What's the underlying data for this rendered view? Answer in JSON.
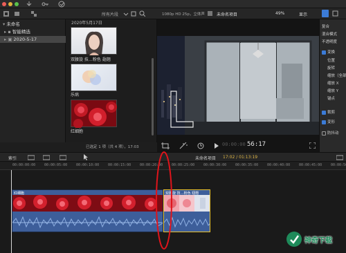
{
  "toolbar": {
    "browser_filter": "所有片段",
    "viewer_format": "1080p HD 25p，立体声",
    "project_name": "未命名项目",
    "zoom": "49%",
    "display_menu": "显示"
  },
  "library": {
    "items": [
      {
        "label": "未命名"
      },
      {
        "label": "智能精选"
      },
      {
        "label": "2020-5-17"
      }
    ]
  },
  "browser": {
    "date_header": "2020年5月17日",
    "clips": [
      {
        "label": "双腰旋 技…粉色 翅翘"
      },
      {
        "label": "乐病"
      },
      {
        "label": "红细胞"
      }
    ],
    "status": "已选定 1 项（共 4 项），17:03"
  },
  "viewer": {
    "timecode": "56:17"
  },
  "inspector": {
    "rows": [
      {
        "label": "复合",
        "check": false
      },
      {
        "label": "混合模式",
        "check": false
      },
      {
        "label": "不透明度",
        "check": false
      },
      {
        "label": "变换",
        "check": true
      },
      {
        "label": "位置",
        "check": false
      },
      {
        "label": "旋转",
        "check": false
      },
      {
        "label": "缩放（全部）",
        "check": false
      },
      {
        "label": "缩放 X",
        "check": false
      },
      {
        "label": "缩放 Y",
        "check": false
      },
      {
        "label": "锚点",
        "check": false
      },
      {
        "label": "裁剪",
        "check": true
      },
      {
        "label": "变形",
        "check": true
      },
      {
        "label": "防抖动",
        "check": false
      }
    ]
  },
  "timeline": {
    "index_label": "索引",
    "project_label": "未命名项目",
    "duration": "17:02 / 01:13:19",
    "ruler_ticks": [
      "00:00:00:00",
      "00:00:05:00",
      "00:00:10:00",
      "00:00:15:00",
      "00:00:20:00",
      "00:00:25:00",
      "00:00:30:00",
      "00:00:35:00",
      "00:00:40:00",
      "00:00:45:00",
      "00:00:50:00"
    ],
    "clip1_label": "红细胞",
    "clip2_label": "双腰旋 技…粉色 翅翘"
  },
  "watermark": {
    "text": "神奇下载"
  },
  "colors": {
    "accent_blue": "#3b7bd6",
    "clip_blue": "#3d5e9a",
    "annotation_red": "#e0141b",
    "selection_yellow": "#e9c12b"
  }
}
